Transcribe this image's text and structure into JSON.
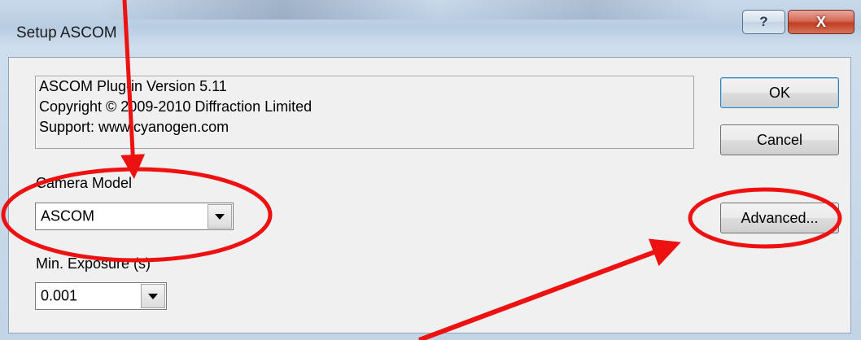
{
  "window": {
    "title": "Setup ASCOM",
    "help_label": "?",
    "close_label": "X"
  },
  "info": {
    "lines": [
      "ASCOM Plug-in Version 5.11",
      "Copyright © 2009-2010 Diffraction Limited",
      "Support: www.cyanogen.com"
    ]
  },
  "camera_model": {
    "label": "Camera Model",
    "value": "ASCOM"
  },
  "min_exposure": {
    "label": "Min. Exposure (s)",
    "value": "0.001"
  },
  "buttons": {
    "ok": "OK",
    "cancel": "Cancel",
    "advanced": "Advanced..."
  },
  "annotation": {
    "color": "#ee1111"
  }
}
